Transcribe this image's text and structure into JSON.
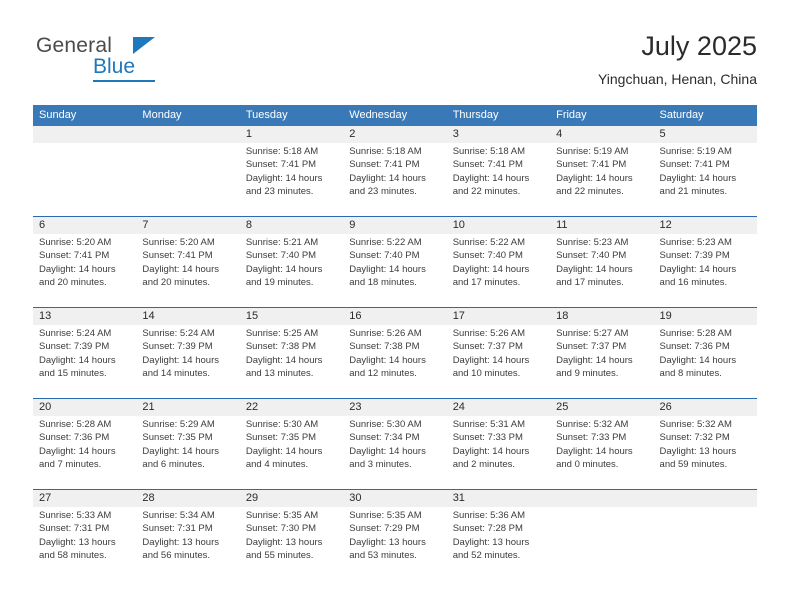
{
  "brand": {
    "name_part1": "General",
    "name_part2": "Blue",
    "triangle_color": "#1f77bc"
  },
  "header": {
    "title": "July 2025",
    "subtitle": "Yingchuan, Henan, China"
  },
  "theme": {
    "header_bar_color": "#3a79b8",
    "week_rule_color": "#2a6ab0",
    "daynum_band_color": "#f0f0f0"
  },
  "weekdays": [
    "Sunday",
    "Monday",
    "Tuesday",
    "Wednesday",
    "Thursday",
    "Friday",
    "Saturday"
  ],
  "weeks": [
    [
      {
        "day": "",
        "sunrise": "",
        "sunset": "",
        "daylight1": "",
        "daylight2": ""
      },
      {
        "day": "",
        "sunrise": "",
        "sunset": "",
        "daylight1": "",
        "daylight2": ""
      },
      {
        "day": "1",
        "sunrise": "Sunrise: 5:18 AM",
        "sunset": "Sunset: 7:41 PM",
        "daylight1": "Daylight: 14 hours",
        "daylight2": "and 23 minutes."
      },
      {
        "day": "2",
        "sunrise": "Sunrise: 5:18 AM",
        "sunset": "Sunset: 7:41 PM",
        "daylight1": "Daylight: 14 hours",
        "daylight2": "and 23 minutes."
      },
      {
        "day": "3",
        "sunrise": "Sunrise: 5:18 AM",
        "sunset": "Sunset: 7:41 PM",
        "daylight1": "Daylight: 14 hours",
        "daylight2": "and 22 minutes."
      },
      {
        "day": "4",
        "sunrise": "Sunrise: 5:19 AM",
        "sunset": "Sunset: 7:41 PM",
        "daylight1": "Daylight: 14 hours",
        "daylight2": "and 22 minutes."
      },
      {
        "day": "5",
        "sunrise": "Sunrise: 5:19 AM",
        "sunset": "Sunset: 7:41 PM",
        "daylight1": "Daylight: 14 hours",
        "daylight2": "and 21 minutes."
      }
    ],
    [
      {
        "day": "6",
        "sunrise": "Sunrise: 5:20 AM",
        "sunset": "Sunset: 7:41 PM",
        "daylight1": "Daylight: 14 hours",
        "daylight2": "and 20 minutes."
      },
      {
        "day": "7",
        "sunrise": "Sunrise: 5:20 AM",
        "sunset": "Sunset: 7:41 PM",
        "daylight1": "Daylight: 14 hours",
        "daylight2": "and 20 minutes."
      },
      {
        "day": "8",
        "sunrise": "Sunrise: 5:21 AM",
        "sunset": "Sunset: 7:40 PM",
        "daylight1": "Daylight: 14 hours",
        "daylight2": "and 19 minutes."
      },
      {
        "day": "9",
        "sunrise": "Sunrise: 5:22 AM",
        "sunset": "Sunset: 7:40 PM",
        "daylight1": "Daylight: 14 hours",
        "daylight2": "and 18 minutes."
      },
      {
        "day": "10",
        "sunrise": "Sunrise: 5:22 AM",
        "sunset": "Sunset: 7:40 PM",
        "daylight1": "Daylight: 14 hours",
        "daylight2": "and 17 minutes."
      },
      {
        "day": "11",
        "sunrise": "Sunrise: 5:23 AM",
        "sunset": "Sunset: 7:40 PM",
        "daylight1": "Daylight: 14 hours",
        "daylight2": "and 17 minutes."
      },
      {
        "day": "12",
        "sunrise": "Sunrise: 5:23 AM",
        "sunset": "Sunset: 7:39 PM",
        "daylight1": "Daylight: 14 hours",
        "daylight2": "and 16 minutes."
      }
    ],
    [
      {
        "day": "13",
        "sunrise": "Sunrise: 5:24 AM",
        "sunset": "Sunset: 7:39 PM",
        "daylight1": "Daylight: 14 hours",
        "daylight2": "and 15 minutes."
      },
      {
        "day": "14",
        "sunrise": "Sunrise: 5:24 AM",
        "sunset": "Sunset: 7:39 PM",
        "daylight1": "Daylight: 14 hours",
        "daylight2": "and 14 minutes."
      },
      {
        "day": "15",
        "sunrise": "Sunrise: 5:25 AM",
        "sunset": "Sunset: 7:38 PM",
        "daylight1": "Daylight: 14 hours",
        "daylight2": "and 13 minutes."
      },
      {
        "day": "16",
        "sunrise": "Sunrise: 5:26 AM",
        "sunset": "Sunset: 7:38 PM",
        "daylight1": "Daylight: 14 hours",
        "daylight2": "and 12 minutes."
      },
      {
        "day": "17",
        "sunrise": "Sunrise: 5:26 AM",
        "sunset": "Sunset: 7:37 PM",
        "daylight1": "Daylight: 14 hours",
        "daylight2": "and 10 minutes."
      },
      {
        "day": "18",
        "sunrise": "Sunrise: 5:27 AM",
        "sunset": "Sunset: 7:37 PM",
        "daylight1": "Daylight: 14 hours",
        "daylight2": "and 9 minutes."
      },
      {
        "day": "19",
        "sunrise": "Sunrise: 5:28 AM",
        "sunset": "Sunset: 7:36 PM",
        "daylight1": "Daylight: 14 hours",
        "daylight2": "and 8 minutes."
      }
    ],
    [
      {
        "day": "20",
        "sunrise": "Sunrise: 5:28 AM",
        "sunset": "Sunset: 7:36 PM",
        "daylight1": "Daylight: 14 hours",
        "daylight2": "and 7 minutes."
      },
      {
        "day": "21",
        "sunrise": "Sunrise: 5:29 AM",
        "sunset": "Sunset: 7:35 PM",
        "daylight1": "Daylight: 14 hours",
        "daylight2": "and 6 minutes."
      },
      {
        "day": "22",
        "sunrise": "Sunrise: 5:30 AM",
        "sunset": "Sunset: 7:35 PM",
        "daylight1": "Daylight: 14 hours",
        "daylight2": "and 4 minutes."
      },
      {
        "day": "23",
        "sunrise": "Sunrise: 5:30 AM",
        "sunset": "Sunset: 7:34 PM",
        "daylight1": "Daylight: 14 hours",
        "daylight2": "and 3 minutes."
      },
      {
        "day": "24",
        "sunrise": "Sunrise: 5:31 AM",
        "sunset": "Sunset: 7:33 PM",
        "daylight1": "Daylight: 14 hours",
        "daylight2": "and 2 minutes."
      },
      {
        "day": "25",
        "sunrise": "Sunrise: 5:32 AM",
        "sunset": "Sunset: 7:33 PM",
        "daylight1": "Daylight: 14 hours",
        "daylight2": "and 0 minutes."
      },
      {
        "day": "26",
        "sunrise": "Sunrise: 5:32 AM",
        "sunset": "Sunset: 7:32 PM",
        "daylight1": "Daylight: 13 hours",
        "daylight2": "and 59 minutes."
      }
    ],
    [
      {
        "day": "27",
        "sunrise": "Sunrise: 5:33 AM",
        "sunset": "Sunset: 7:31 PM",
        "daylight1": "Daylight: 13 hours",
        "daylight2": "and 58 minutes."
      },
      {
        "day": "28",
        "sunrise": "Sunrise: 5:34 AM",
        "sunset": "Sunset: 7:31 PM",
        "daylight1": "Daylight: 13 hours",
        "daylight2": "and 56 minutes."
      },
      {
        "day": "29",
        "sunrise": "Sunrise: 5:35 AM",
        "sunset": "Sunset: 7:30 PM",
        "daylight1": "Daylight: 13 hours",
        "daylight2": "and 55 minutes."
      },
      {
        "day": "30",
        "sunrise": "Sunrise: 5:35 AM",
        "sunset": "Sunset: 7:29 PM",
        "daylight1": "Daylight: 13 hours",
        "daylight2": "and 53 minutes."
      },
      {
        "day": "31",
        "sunrise": "Sunrise: 5:36 AM",
        "sunset": "Sunset: 7:28 PM",
        "daylight1": "Daylight: 13 hours",
        "daylight2": "and 52 minutes."
      },
      {
        "day": "",
        "sunrise": "",
        "sunset": "",
        "daylight1": "",
        "daylight2": ""
      },
      {
        "day": "",
        "sunrise": "",
        "sunset": "",
        "daylight1": "",
        "daylight2": ""
      }
    ]
  ]
}
